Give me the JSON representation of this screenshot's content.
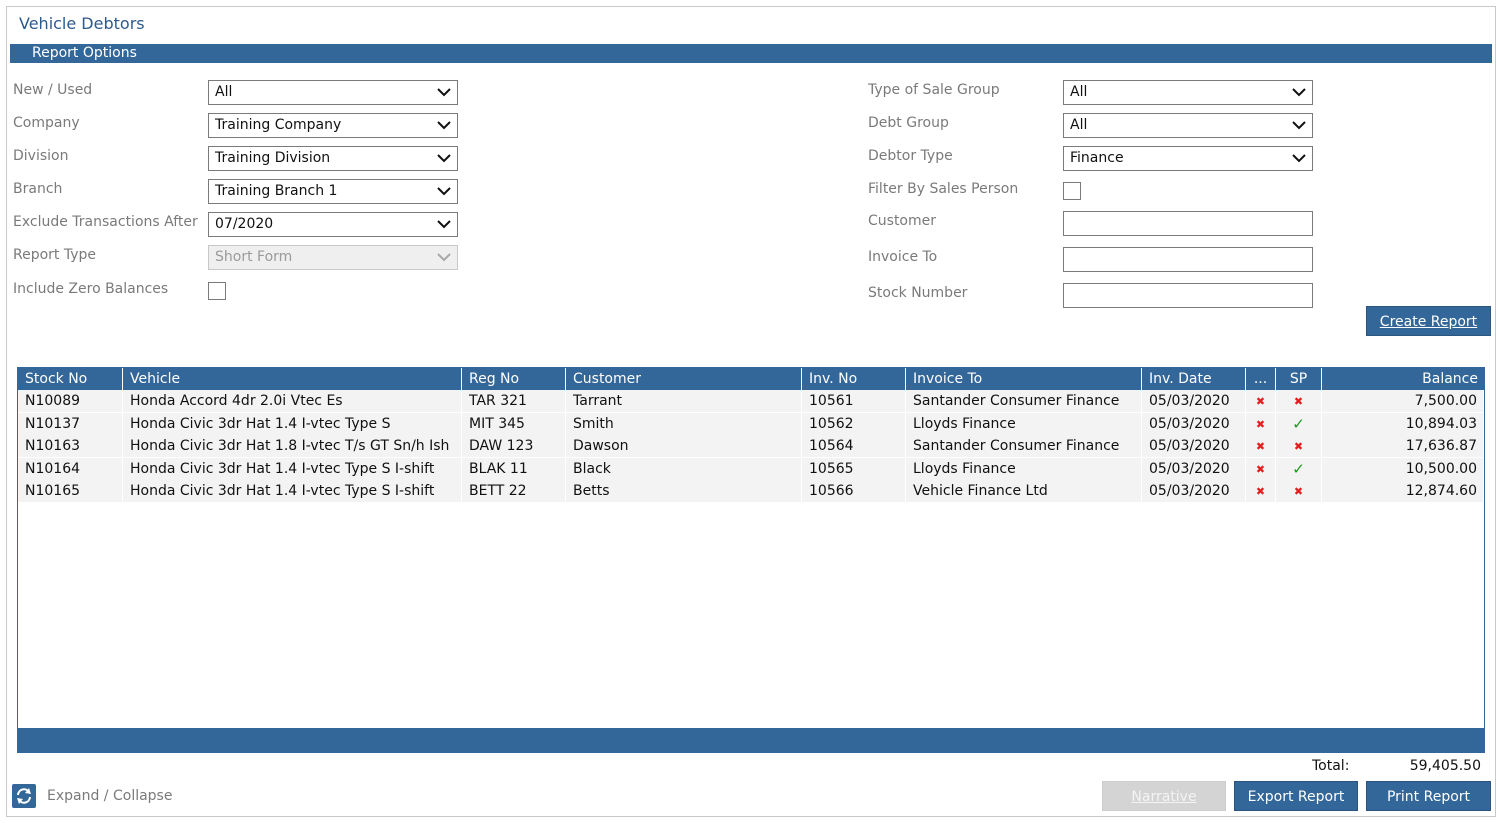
{
  "page_title": "Vehicle Debtors",
  "section_title": "Report Options",
  "left_options": [
    {
      "label": "New / Used",
      "type": "select",
      "value": "All"
    },
    {
      "label": "Company",
      "type": "select",
      "value": "Training Company"
    },
    {
      "label": "Division",
      "type": "select",
      "value": "Training Division"
    },
    {
      "label": "Branch",
      "type": "select",
      "value": "Training Branch 1"
    },
    {
      "label": "Exclude Transactions After",
      "type": "select",
      "value": "07/2020"
    },
    {
      "label": "Report Type",
      "type": "select",
      "value": "Short Form",
      "disabled": true
    },
    {
      "label": "Include Zero Balances",
      "type": "checkbox",
      "checked": false
    }
  ],
  "right_options": [
    {
      "label": "Type of Sale Group",
      "type": "select",
      "value": "All"
    },
    {
      "label": "Debt Group",
      "type": "select",
      "value": "All"
    },
    {
      "label": "Debtor Type",
      "type": "select",
      "value": "Finance"
    },
    {
      "label": "Filter By Sales Person",
      "type": "checkbox",
      "checked": false
    },
    {
      "label": "Customer",
      "type": "text",
      "value": ""
    },
    {
      "label": "Invoice To",
      "type": "text",
      "value": ""
    },
    {
      "label": "Stock Number",
      "type": "text",
      "value": ""
    }
  ],
  "create_report_label": "Create Report",
  "grid": {
    "columns": [
      "Stock No",
      "Vehicle",
      "Reg No",
      "Customer",
      "Inv. No",
      "Invoice To",
      "Inv. Date",
      "...",
      "SP",
      "Balance"
    ],
    "rows": [
      {
        "stock_no": "N10089",
        "vehicle": "Honda Accord 4dr 2.0i Vtec Es",
        "reg_no": "TAR 321",
        "customer": "Tarrant",
        "inv_no": "10561",
        "invoice_to": "Santander Consumer Finance",
        "inv_date": "05/03/2020",
        "dots": "cross",
        "sp": "cross",
        "balance": "7,500.00"
      },
      {
        "stock_no": "N10137",
        "vehicle": "Honda Civic 3dr Hat 1.4 I-vtec Type S",
        "reg_no": "MIT 345",
        "customer": "Smith",
        "inv_no": "10562",
        "invoice_to": "Lloyds Finance",
        "inv_date": "05/03/2020",
        "dots": "cross",
        "sp": "tick",
        "balance": "10,894.03"
      },
      {
        "stock_no": "N10163",
        "vehicle": "Honda Civic 3dr Hat 1.8 I-vtec T/s GT Sn/h Ish",
        "reg_no": "DAW 123",
        "customer": "Dawson",
        "inv_no": "10564",
        "invoice_to": "Santander Consumer Finance",
        "inv_date": "05/03/2020",
        "dots": "cross",
        "sp": "cross",
        "balance": "17,636.87"
      },
      {
        "stock_no": "N10164",
        "vehicle": "Honda Civic 3dr Hat 1.4 I-vtec Type S I-shift",
        "reg_no": "BLAK 11",
        "customer": "Black",
        "inv_no": "10565",
        "invoice_to": "Lloyds Finance",
        "inv_date": "05/03/2020",
        "dots": "cross",
        "sp": "tick",
        "balance": "10,500.00"
      },
      {
        "stock_no": "N10165",
        "vehicle": "Honda Civic 3dr Hat 1.4 I-vtec Type S I-shift",
        "reg_no": "BETT 22",
        "customer": "Betts",
        "inv_no": "10566",
        "invoice_to": "Vehicle Finance Ltd",
        "inv_date": "05/03/2020",
        "dots": "cross",
        "sp": "cross",
        "balance": "12,874.60"
      }
    ]
  },
  "total_label": "Total:",
  "total_value": "59,405.50",
  "expand_collapse_label": "Expand / Collapse",
  "narrative_label": "Narrative",
  "export_report_label": "Export Report",
  "print_report_label": "Print Report",
  "accent_color": "#336699"
}
